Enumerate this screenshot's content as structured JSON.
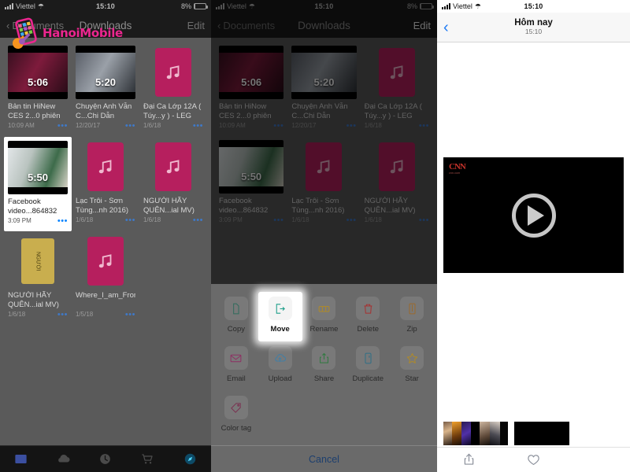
{
  "watermark": {
    "text": "HanoiMobile",
    "icon": "phone-wrench-logo"
  },
  "panel1": {
    "status": {
      "carrier": "Viettel",
      "time": "15:10",
      "battery": "8%",
      "wifi_icon": "wifi-icon",
      "signal_icon": "signal-bars-icon",
      "battery_icon": "battery-icon"
    },
    "nav": {
      "back": "Documents",
      "title": "Downloads",
      "edit": "Edit"
    },
    "files": [
      {
        "name": "Bản tin HiNew CES 2...0 phiên",
        "date": "10:09 AM",
        "kind": "video",
        "duration": "5:06",
        "menu": "•••"
      },
      {
        "name": "Chuyện Anh Vẫn C...Chi Dẫn",
        "date": "12/20/17",
        "kind": "video",
        "duration": "5:20",
        "menu": "•••"
      },
      {
        "name": "Đại Ca Lớp 12A ( Túy...y ) - LEG",
        "date": "1/6/18",
        "kind": "music",
        "duration": "",
        "menu": "•••"
      },
      {
        "name": "Facebook video...864832",
        "date": "3:09 PM",
        "kind": "video",
        "duration": "5:50",
        "menu": "•••",
        "selected": true
      },
      {
        "name": "Lạc Trôi - Sơn Tùng...nh 2016)",
        "date": "1/6/18",
        "kind": "music",
        "duration": "",
        "menu": "•••"
      },
      {
        "name": "NGƯỜI HÃY QUÊN...ial MV)",
        "date": "1/6/18",
        "kind": "music",
        "duration": "",
        "menu": "•••"
      },
      {
        "name": "NGƯỜI HÃY QUÊN...ial MV)",
        "date": "1/6/18",
        "kind": "doc",
        "duration": "",
        "menu": "•••"
      },
      {
        "name": "Where_I_am_From",
        "date": "1/5/18",
        "kind": "music",
        "duration": "",
        "menu": "•••"
      }
    ],
    "tabs": [
      {
        "name": "documents-tab",
        "icon": "folder-icon"
      },
      {
        "name": "cloud-tab",
        "icon": "cloud-icon"
      },
      {
        "name": "recent-tab",
        "icon": "clock-icon"
      },
      {
        "name": "store-tab",
        "icon": "cart-icon"
      },
      {
        "name": "browser-tab",
        "icon": "compass-icon"
      }
    ]
  },
  "panel2": {
    "status": {
      "carrier": "Viettel",
      "time": "15:10",
      "battery": "8%"
    },
    "nav": {
      "back": "Documents",
      "title": "Downloads",
      "edit": "Edit"
    },
    "files": [
      {
        "name": "Bản tin HiNow CES 2...0 phiên",
        "date": "10:09 AM",
        "kind": "video",
        "duration": "5:06",
        "menu": "•••"
      },
      {
        "name": "Chuyện Anh Vẫn C...Chi Dẫn",
        "date": "12/20/17",
        "kind": "video",
        "duration": "5:20",
        "menu": "•••"
      },
      {
        "name": "Đại Ca Lớp 12A ( Túy...y ) - LEG",
        "date": "1/6/18",
        "kind": "music",
        "duration": "",
        "menu": "•••"
      },
      {
        "name": "Facebook video...864832",
        "date": "3:09 PM",
        "kind": "video",
        "duration": "5:50",
        "menu": "•••"
      },
      {
        "name": "Lạc Trôi - Sơn Tùng...nh 2016)",
        "date": "1/6/18",
        "kind": "music",
        "duration": "",
        "menu": "•••"
      },
      {
        "name": "NGƯỜI HÃY QUÊN...ial MV)",
        "date": "1/6/18",
        "kind": "music",
        "duration": "",
        "menu": "•••"
      }
    ],
    "sheet": {
      "actions": [
        {
          "label": "Copy",
          "icon": "copy-document-icon",
          "highlighted": false
        },
        {
          "label": "Move",
          "icon": "move-arrow-icon",
          "highlighted": true
        },
        {
          "label": "Rename",
          "icon": "rename-tag-icon",
          "highlighted": false
        },
        {
          "label": "Delete",
          "icon": "trash-icon",
          "highlighted": false
        },
        {
          "label": "Zip",
          "icon": "zip-archive-icon",
          "highlighted": false
        },
        {
          "label": "Email",
          "icon": "envelope-icon",
          "highlighted": false
        },
        {
          "label": "Upload",
          "icon": "cloud-upload-icon",
          "highlighted": false
        },
        {
          "label": "Share",
          "icon": "share-box-icon",
          "highlighted": false
        },
        {
          "label": "Duplicate",
          "icon": "duplicate-icon",
          "highlighted": false
        },
        {
          "label": "Star",
          "icon": "star-icon",
          "highlighted": false
        },
        {
          "label": "Color tag",
          "icon": "color-tag-icon",
          "highlighted": false
        }
      ],
      "cancel": "Cancel"
    }
  },
  "panel3": {
    "status": {
      "carrier": "Viettel",
      "time": "15:10"
    },
    "nav": {
      "back_icon": "chevron-left-icon",
      "title": "Hôm nay",
      "subtitle": "15:10"
    },
    "video": {
      "logo": "CNN",
      "logo_sub": "cnn.com",
      "play_icon": "play-button-icon"
    },
    "bottom": {
      "share_icon": "share-icon",
      "favorite_icon": "heart-icon"
    }
  }
}
